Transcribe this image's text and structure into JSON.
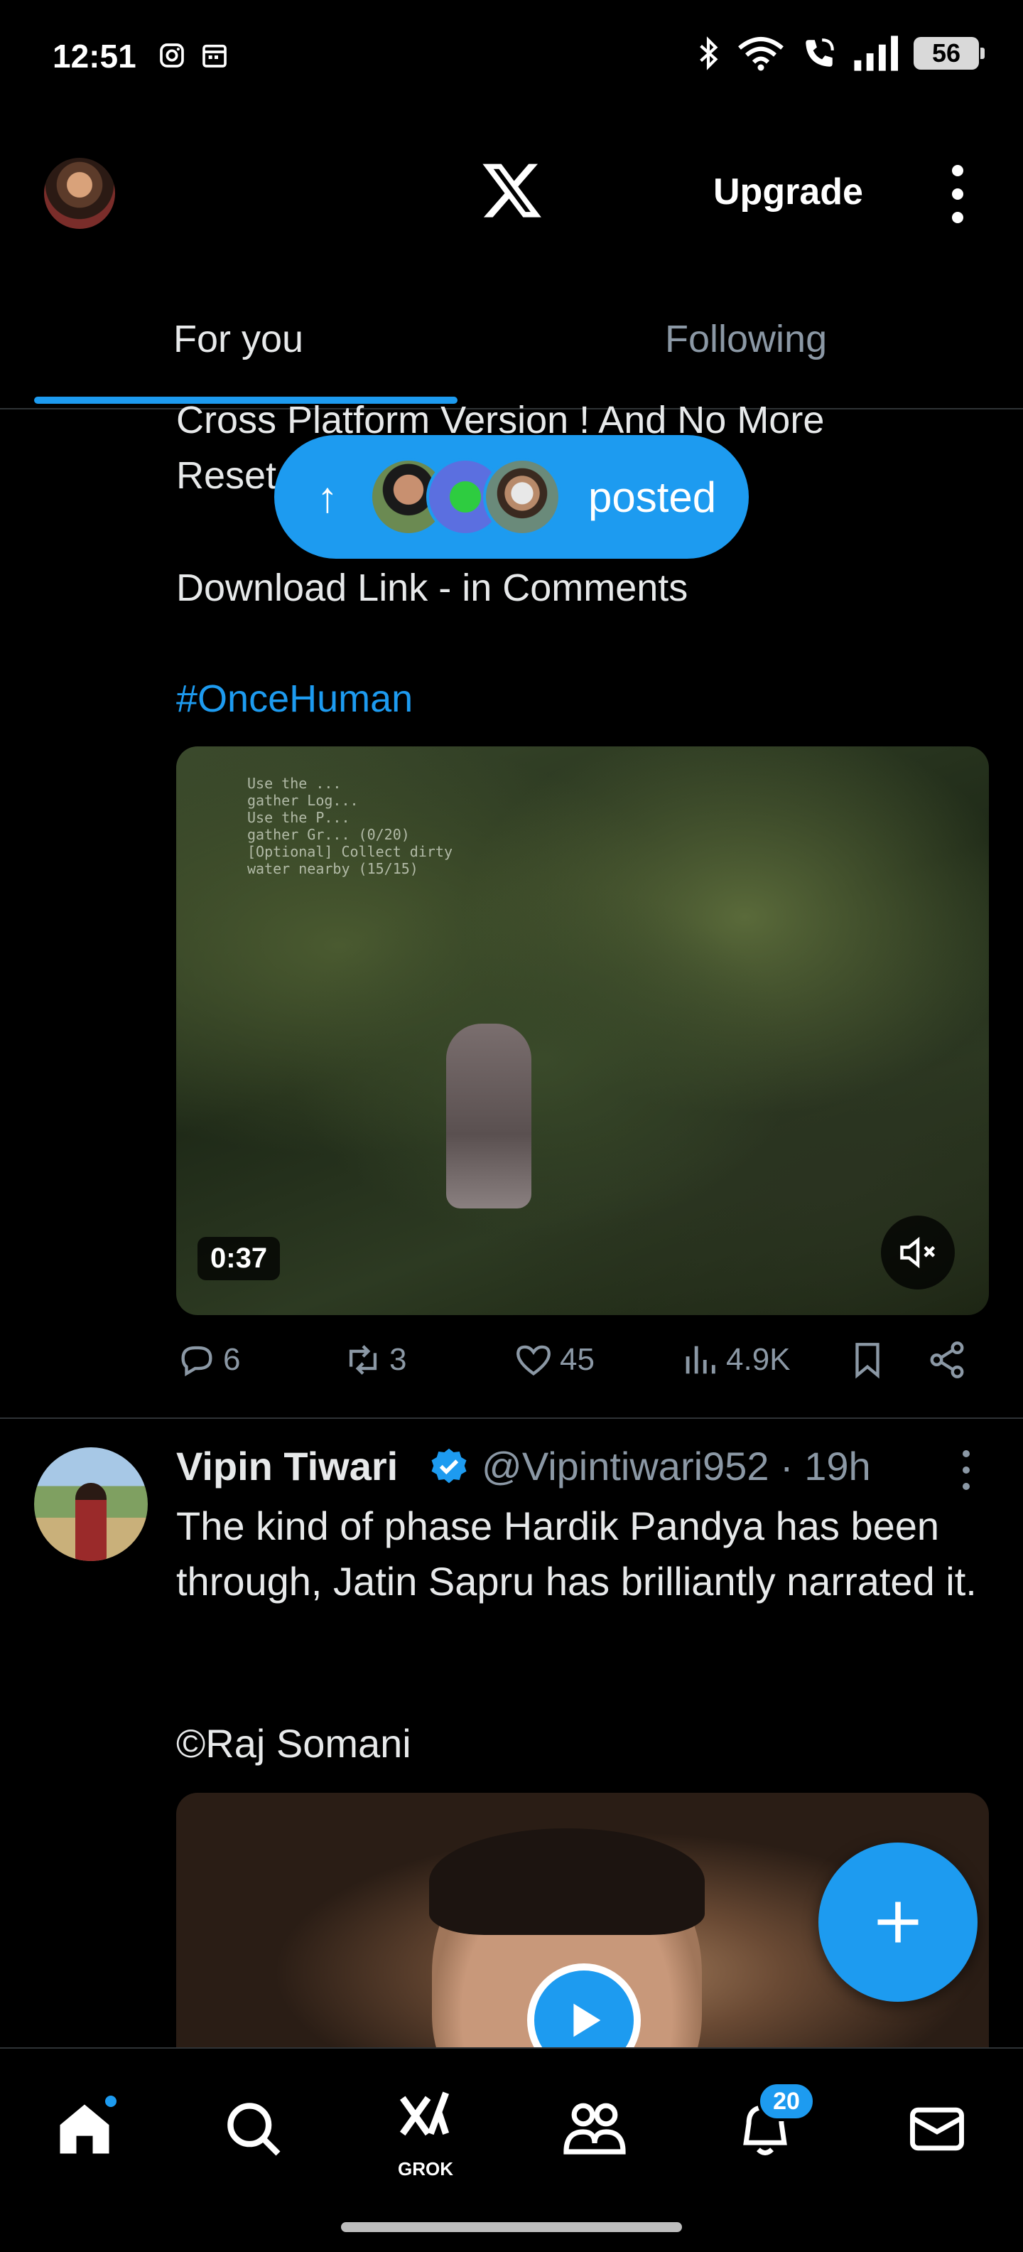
{
  "status_bar": {
    "time": "12:51",
    "battery": "56",
    "left_icons": [
      "instagram-icon",
      "calendar-icon"
    ],
    "right_icons": [
      "bluetooth-icon",
      "wifi-icon",
      "call-icon",
      "signal-icon",
      "battery-icon"
    ]
  },
  "header": {
    "logo": "x-logo-icon",
    "upgrade_label": "Upgrade"
  },
  "tabs": [
    {
      "label": "For you",
      "active": true
    },
    {
      "label": "Following",
      "active": false
    }
  ],
  "new_posts_pill": {
    "label": "posted"
  },
  "post1": {
    "text_line1": "Cross Platform Version ! And No More",
    "text_line2": "Reset",
    "download_text": "Download Link - in Comments",
    "hashtag": "#OnceHuman",
    "video": {
      "duration": "0:37",
      "hud_text": "Use the ... \ngather Log...\nUse the P...\ngather Gr... (0/20)\n[Optional] Collect dirty\nwater nearby (15/15)"
    },
    "actions": {
      "replies": "6",
      "reposts": "3",
      "likes": "45",
      "views": "4.9K"
    }
  },
  "post2": {
    "name": "Vipin Tiwari",
    "handle_time": "@Vipintiwari952 · 19h",
    "body": "The kind of phase Hardik Pandya has been through, Jatin Sapru has brilliantly narrated it.",
    "credit": "©Raj Somani"
  },
  "bottom_nav": {
    "grok_label": "GROK",
    "notifications_badge": "20"
  },
  "colors": {
    "accent": "#1d9bf0",
    "background": "#000000",
    "text": "#e7e9ea",
    "muted": "#8b98a5"
  }
}
